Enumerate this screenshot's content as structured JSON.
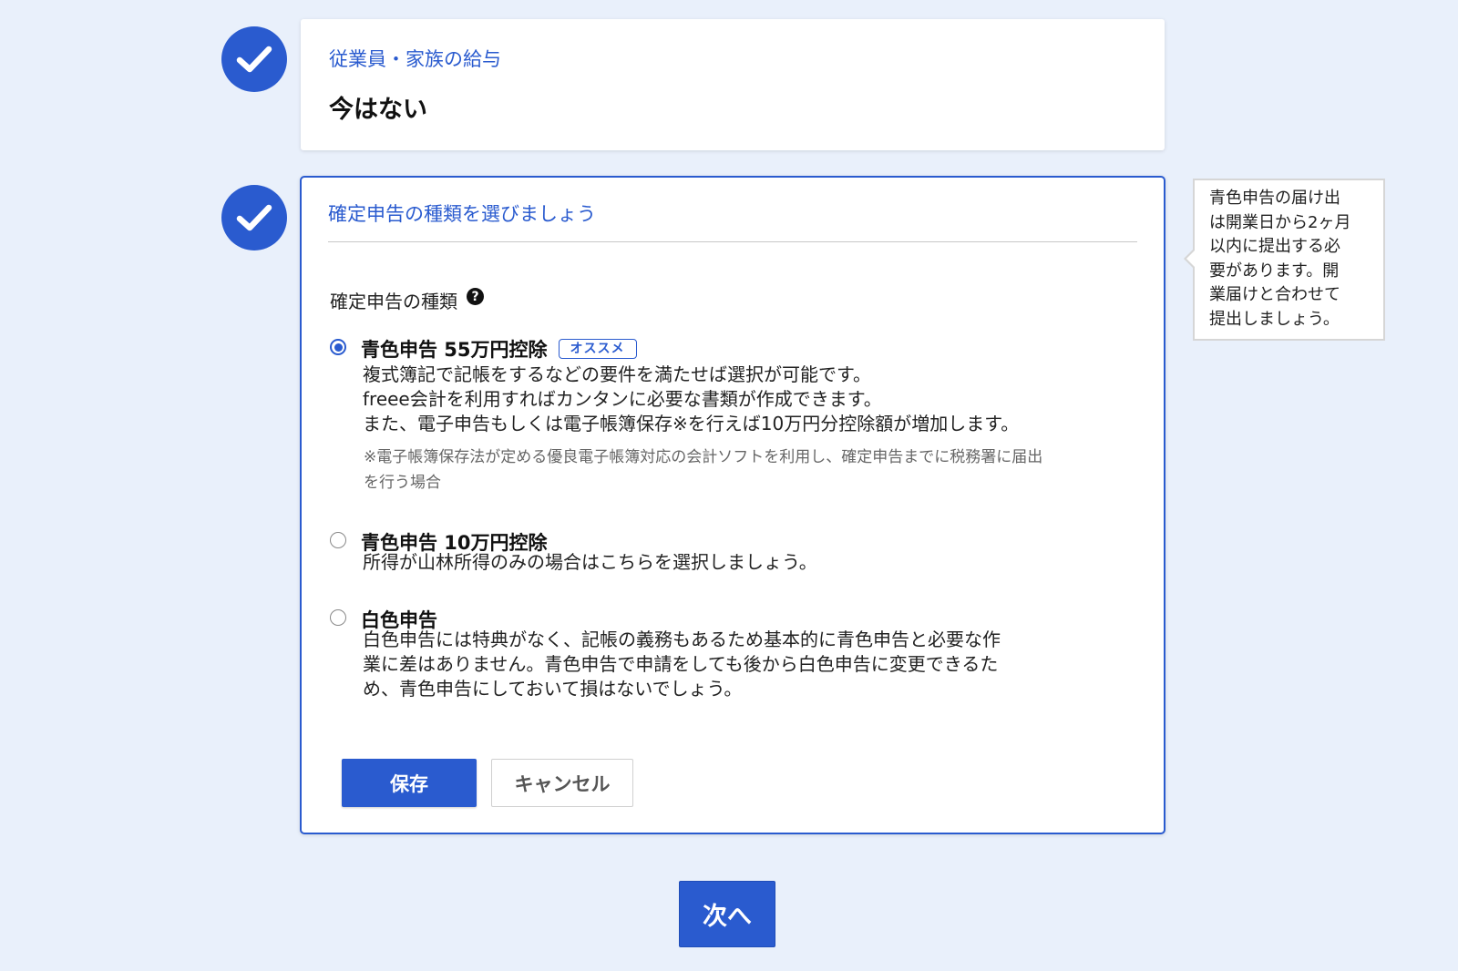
{
  "step1": {
    "label": "従業員・家族の給与",
    "value": "今はない"
  },
  "step2": {
    "heading": "確定申告の種類を選びましょう",
    "field_label": "確定申告の種類",
    "help_glyph": "?",
    "options": [
      {
        "title": "青色申告 55万円控除",
        "badge": "オススメ",
        "selected": true,
        "desc_lines": [
          "複式簿記で記帳をするなどの要件を満たせば選択が可能です。",
          "freee会計を利用すればカンタンに必要な書類が作成できます。",
          "また、電子申告もしくは電子帳簿保存※を行えば10万円分控除額が増加します。"
        ],
        "note_lines": [
          "※電子帳簿保存法が定める優良電子帳簿対応の会計ソフトを利用し、確定申告までに税務署に届出",
          "を行う場合"
        ]
      },
      {
        "title": "青色申告 10万円控除",
        "selected": false,
        "desc_lines": [
          "所得が山林所得のみの場合はこちらを選択しましょう。"
        ]
      },
      {
        "title": "白色申告",
        "selected": false,
        "desc_lines": [
          "白色申告には特典がなく、記帳の義務もあるため基本的に青色申告と必要な作",
          "業に差はありません。青色申告で申請をしても後から白色申告に変更できるた",
          "め、青色申告にしておいて損はないでしょう。"
        ]
      }
    ],
    "save_label": "保存",
    "cancel_label": "キャンセル"
  },
  "tooltip": {
    "lines": [
      "青色申告の届け出",
      "は開業日から2ヶ月",
      "以内に提出する必",
      "要があります。開",
      "業届けと合わせて",
      "提出しましょう。"
    ]
  },
  "next_label": "次へ",
  "colors": {
    "accent": "#2a5bcf",
    "background": "#e9f0fb"
  },
  "icons": {
    "step_check": "checkmark-circle-icon",
    "help": "question-circle-icon"
  }
}
